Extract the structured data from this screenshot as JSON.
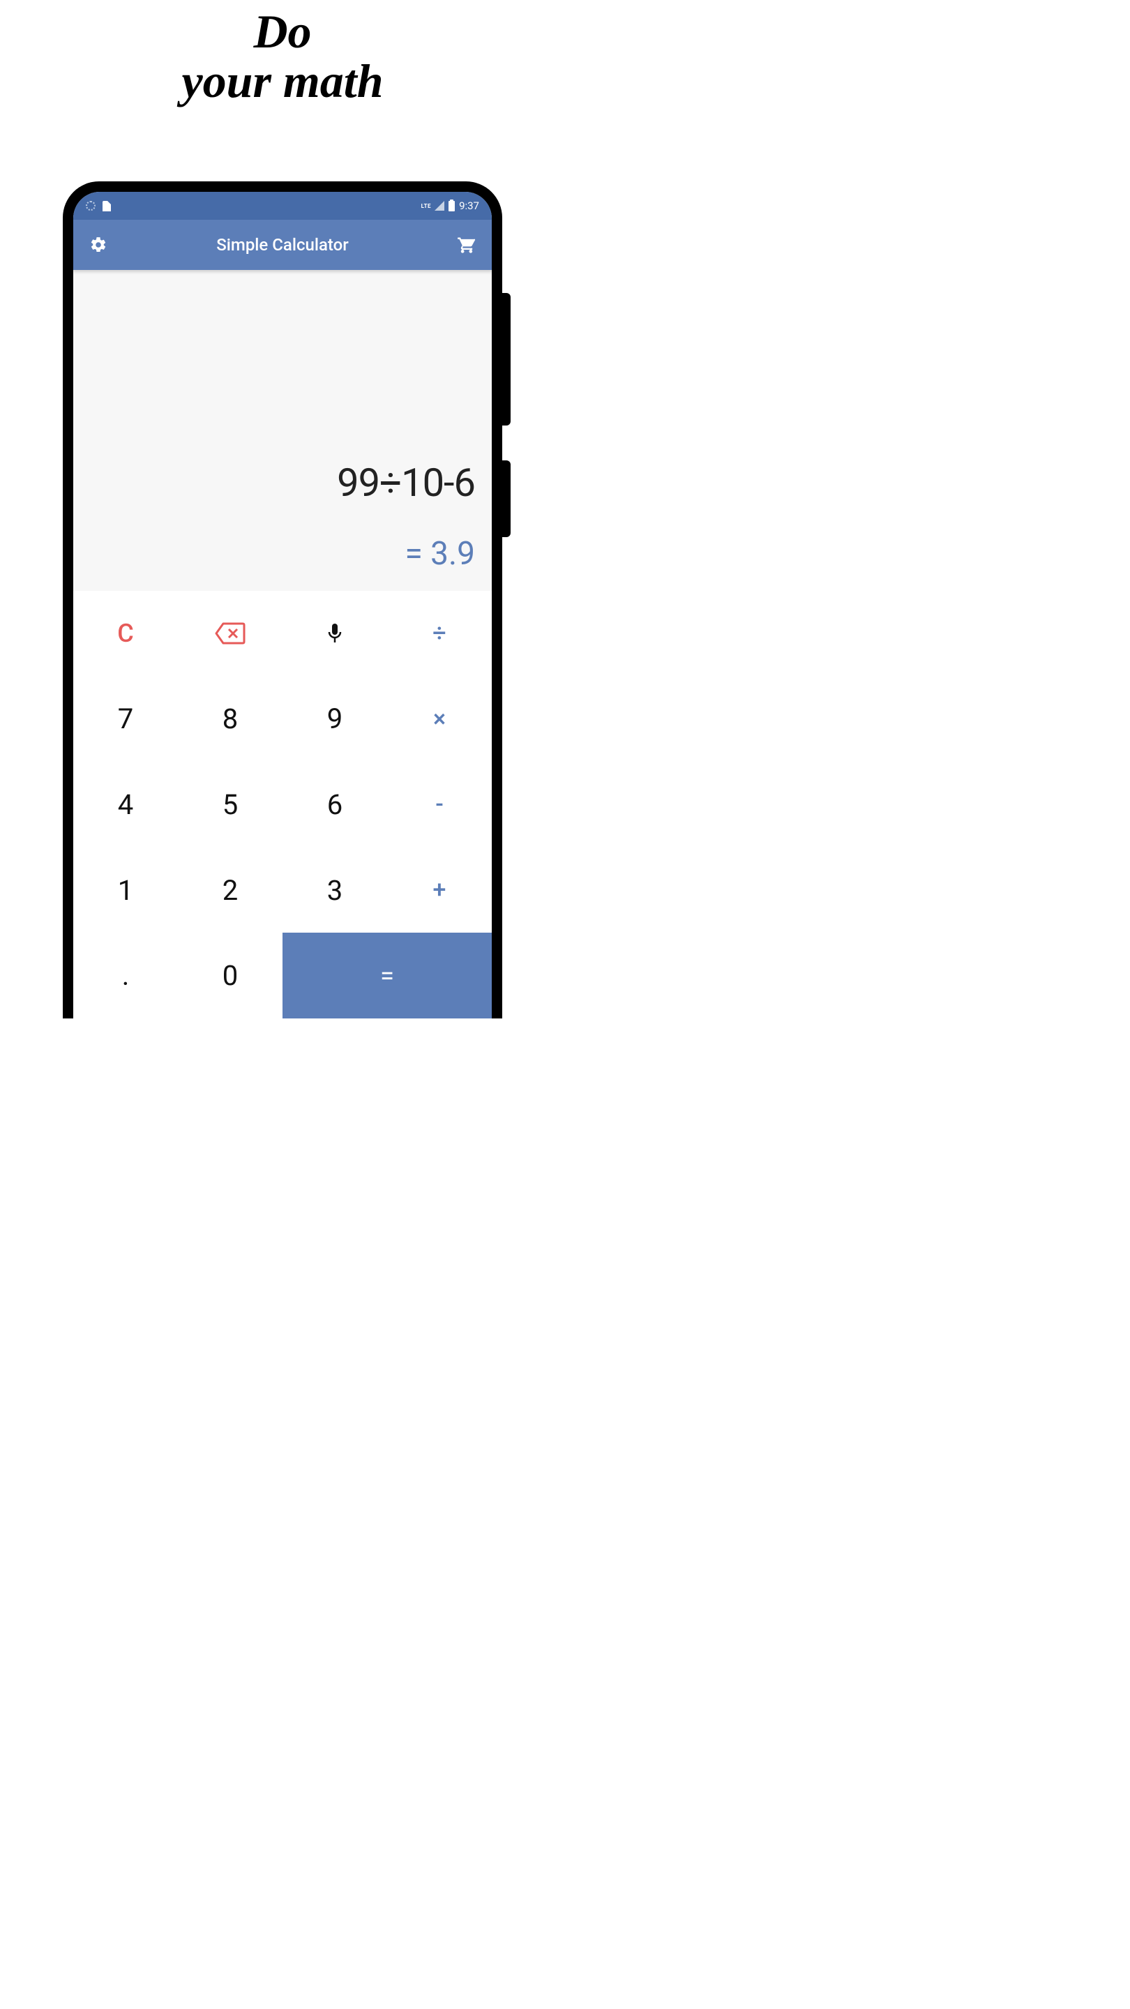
{
  "headline": {
    "line1": "Do",
    "line2": "your math"
  },
  "status": {
    "network_label": "LTE",
    "time": "9:37"
  },
  "appbar": {
    "title": "Simple Calculator"
  },
  "display": {
    "expression": "99÷10-6",
    "result": "= 3.9"
  },
  "keys": {
    "clear": "C",
    "divide": "÷",
    "multiply": "×",
    "minus": "-",
    "plus": "+",
    "equals": "=",
    "dot": ".",
    "n0": "0",
    "n1": "1",
    "n2": "2",
    "n3": "3",
    "n4": "4",
    "n5": "5",
    "n6": "6",
    "n7": "7",
    "n8": "8",
    "n9": "9"
  },
  "colors": {
    "accent": "#5C7EB8",
    "status": "#466BA8",
    "danger": "#E65A58"
  }
}
